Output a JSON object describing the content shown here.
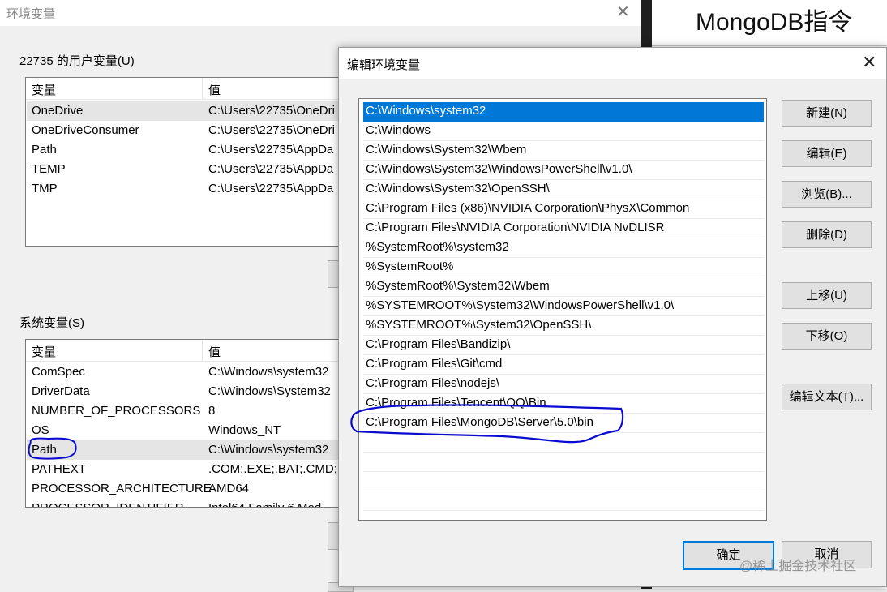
{
  "background_dialog": {
    "title": "环境变量",
    "user_section_label": "22735 的用户变量(U)",
    "system_section_label": "系统变量(S)",
    "headers": {
      "variable": "变量",
      "value": "值"
    },
    "user_vars": [
      {
        "name": "OneDrive",
        "value": "C:\\Users\\22735\\OneDri"
      },
      {
        "name": "OneDriveConsumer",
        "value": "C:\\Users\\22735\\OneDri"
      },
      {
        "name": "Path",
        "value": "C:\\Users\\22735\\AppDa"
      },
      {
        "name": "TEMP",
        "value": "C:\\Users\\22735\\AppDa"
      },
      {
        "name": "TMP",
        "value": "C:\\Users\\22735\\AppDa"
      }
    ],
    "system_vars": [
      {
        "name": "ComSpec",
        "value": "C:\\Windows\\system32"
      },
      {
        "name": "DriverData",
        "value": "C:\\Windows\\System32"
      },
      {
        "name": "NUMBER_OF_PROCESSORS",
        "value": "8"
      },
      {
        "name": "OS",
        "value": "Windows_NT"
      },
      {
        "name": "Path",
        "value": "C:\\Windows\\system32"
      },
      {
        "name": "PATHEXT",
        "value": ".COM;.EXE;.BAT;.CMD;"
      },
      {
        "name": "PROCESSOR_ARCHITECTURE",
        "value": "AMD64"
      },
      {
        "name": "PROCESSOR_IDENTIFIER",
        "value": "Intel64 Family 6 Mod"
      }
    ]
  },
  "side_panel": {
    "heading": "MongoDB指令"
  },
  "edit_dialog": {
    "title": "编辑环境变量",
    "paths": [
      "C:\\Windows\\system32",
      "C:\\Windows",
      "C:\\Windows\\System32\\Wbem",
      "C:\\Windows\\System32\\WindowsPowerShell\\v1.0\\",
      "C:\\Windows\\System32\\OpenSSH\\",
      "C:\\Program Files (x86)\\NVIDIA Corporation\\PhysX\\Common",
      "C:\\Program Files\\NVIDIA Corporation\\NVIDIA NvDLISR",
      "%SystemRoot%\\system32",
      "%SystemRoot%",
      "%SystemRoot%\\System32\\Wbem",
      "%SYSTEMROOT%\\System32\\WindowsPowerShell\\v1.0\\",
      "%SYSTEMROOT%\\System32\\OpenSSH\\",
      "C:\\Program Files\\Bandizip\\",
      "C:\\Program Files\\Git\\cmd",
      "C:\\Program Files\\nodejs\\",
      "C:\\Program Files\\Tencent\\QQ\\Bin",
      "C:\\Program Files\\MongoDB\\Server\\5.0\\bin"
    ],
    "buttons": {
      "new": "新建(N)",
      "edit": "编辑(E)",
      "browse": "浏览(B)...",
      "delete": "删除(D)",
      "move_up": "上移(U)",
      "move_down": "下移(O)",
      "edit_text": "编辑文本(T)...",
      "ok": "确定",
      "cancel": "取消"
    }
  },
  "watermark": "@稀土掘金技术社区",
  "colors": {
    "selection": "#0078d7",
    "annotation_ink": "#0a0ad0"
  }
}
